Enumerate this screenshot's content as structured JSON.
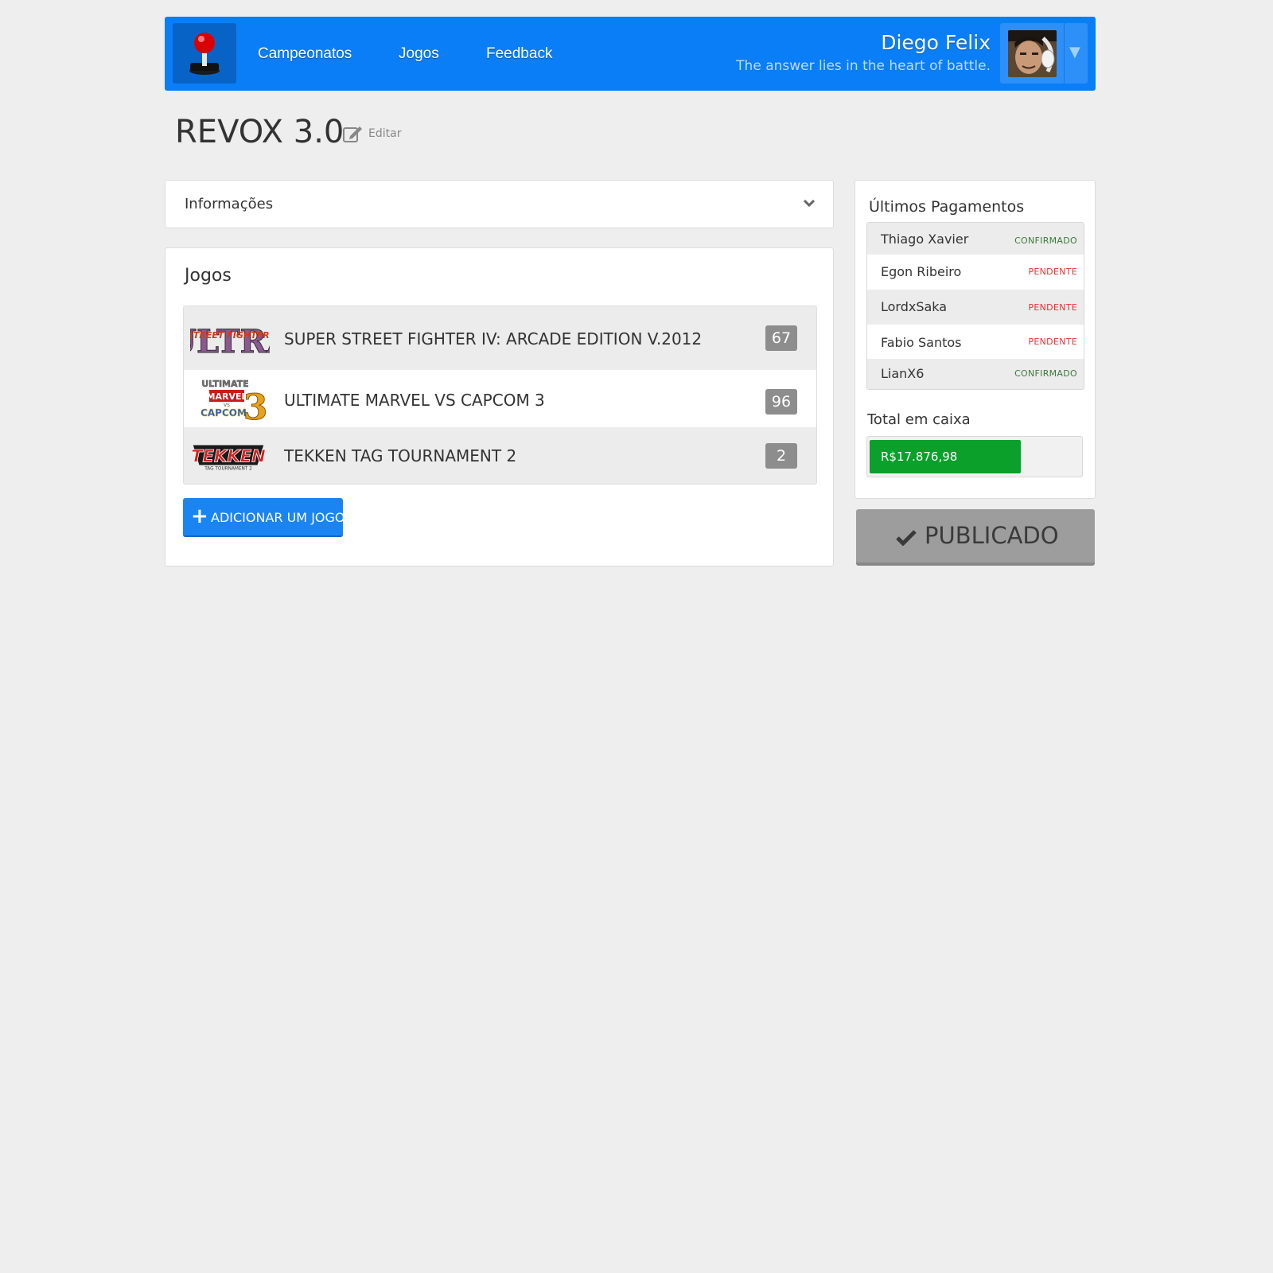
{
  "header": {
    "logo_icon": "joystick-icon",
    "nav": [
      {
        "label": "Campeonatos"
      },
      {
        "label": "Jogos"
      },
      {
        "label": "Feedback"
      }
    ],
    "user": {
      "name": "Diego Felix",
      "tagline": "The answer lies in the heart of battle.",
      "dropdown_icon": "caret-down-icon"
    }
  },
  "page": {
    "title": "REVOX 3.0",
    "edit_label": "Editar"
  },
  "info_panel": {
    "label": "Informações"
  },
  "games": {
    "title": "Jogos",
    "items": [
      {
        "name": "SUPER STREET FIGHTER IV: ARCADE EDITION V.2012",
        "count": "67"
      },
      {
        "name": "ULTIMATE MARVEL VS CAPCOM 3",
        "count": "96"
      },
      {
        "name": "TEKKEN TAG TOURNAMENT 2",
        "count": "2"
      }
    ],
    "logos": [
      {
        "l1": "ULTRA",
        "l2": "STREET FIGHTER IV"
      },
      {
        "l1": "ULTIMATE",
        "l2": "MARVEL",
        "l3": "VS",
        "l4": "CAPCOM",
        "l5": "3"
      },
      {
        "l1": "TEKKEN",
        "l2": "TAG TOURNAMENT 2"
      }
    ],
    "add_button": "ADICIONAR UM JOGO"
  },
  "payments": {
    "title": "Últimos Pagamentos",
    "items": [
      {
        "name": "Thiago Xavier",
        "status": "CONFIRMADO"
      },
      {
        "name": "Egon Ribeiro",
        "status": "PENDENTE"
      },
      {
        "name": "LordxSaka",
        "status": "PENDENTE"
      },
      {
        "name": "Fabio Santos",
        "status": "PENDENTE"
      },
      {
        "name": "LianX6",
        "status": "CONFIRMADO"
      }
    ],
    "cash_title": "Total em caixa",
    "cash_value": "R$17.876,98",
    "cash_fill_percent": 72
  },
  "publish_button": "PUBLICADO",
  "colors": {
    "navbar": "#0a7ef7",
    "primary_button": "#1a85f2",
    "cash_bar": "#0aa02a",
    "confirmed": "#3d7a3d",
    "pending": "#e53333",
    "published_button": "#9d9d9d"
  }
}
